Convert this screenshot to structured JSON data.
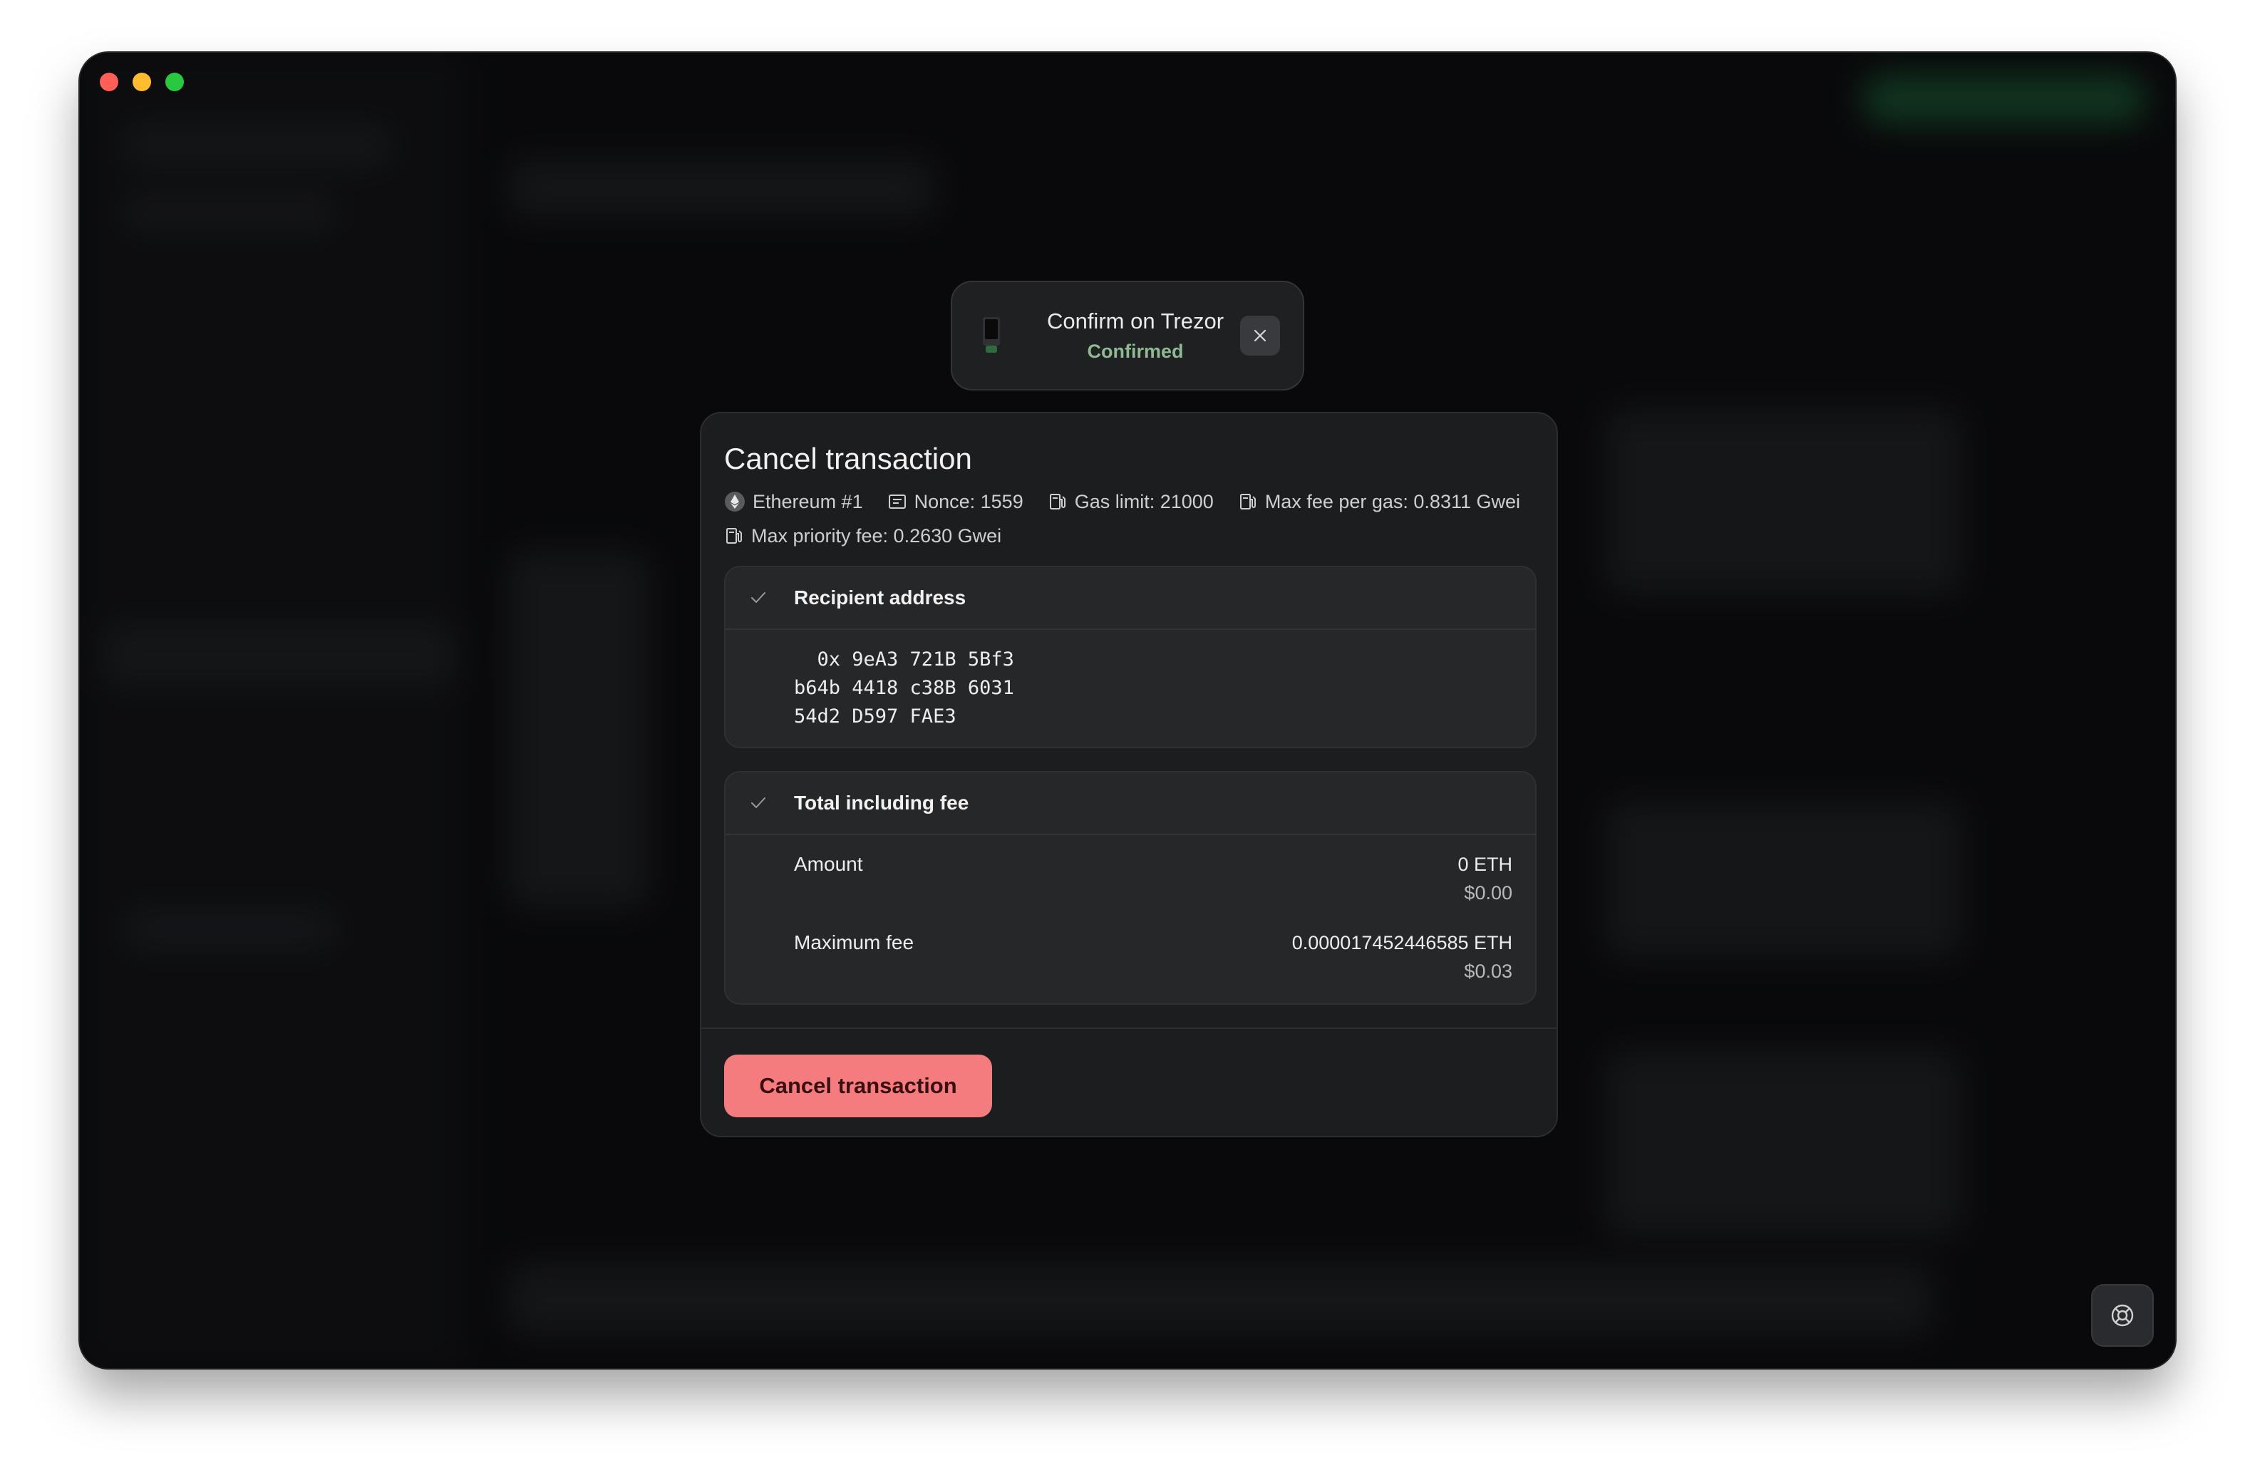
{
  "toast": {
    "title": "Confirm on Trezor",
    "status": "Confirmed",
    "icon": "trezor-device-icon",
    "close_icon": "close-icon"
  },
  "modal": {
    "title": "Cancel transaction",
    "meta": {
      "account": "Ethereum #1",
      "nonce": "Nonce: 1559",
      "gas_limit": "Gas limit: 21000",
      "max_fee_per_gas": "Max fee per gas: 0.8311 Gwei",
      "max_priority_fee": "Max priority fee: 0.2630 Gwei"
    },
    "recipient": {
      "label": "Recipient address",
      "address_lines": [
        "  0x 9eA3 721B 5Bf3",
        "b64b 4418 c38B 6031",
        "54d2 D597 FAE3"
      ]
    },
    "total": {
      "label": "Total including fee",
      "amount_label": "Amount",
      "amount_crypto": "0 ETH",
      "amount_fiat": "$0.00",
      "fee_label": "Maximum fee",
      "fee_crypto": "0.000017452446585 ETH",
      "fee_fiat": "$0.03"
    },
    "action_label": "Cancel transaction"
  },
  "colors": {
    "accent": "#f47b7e",
    "confirmed": "#8fb893",
    "surface": "#1c1d1f"
  }
}
